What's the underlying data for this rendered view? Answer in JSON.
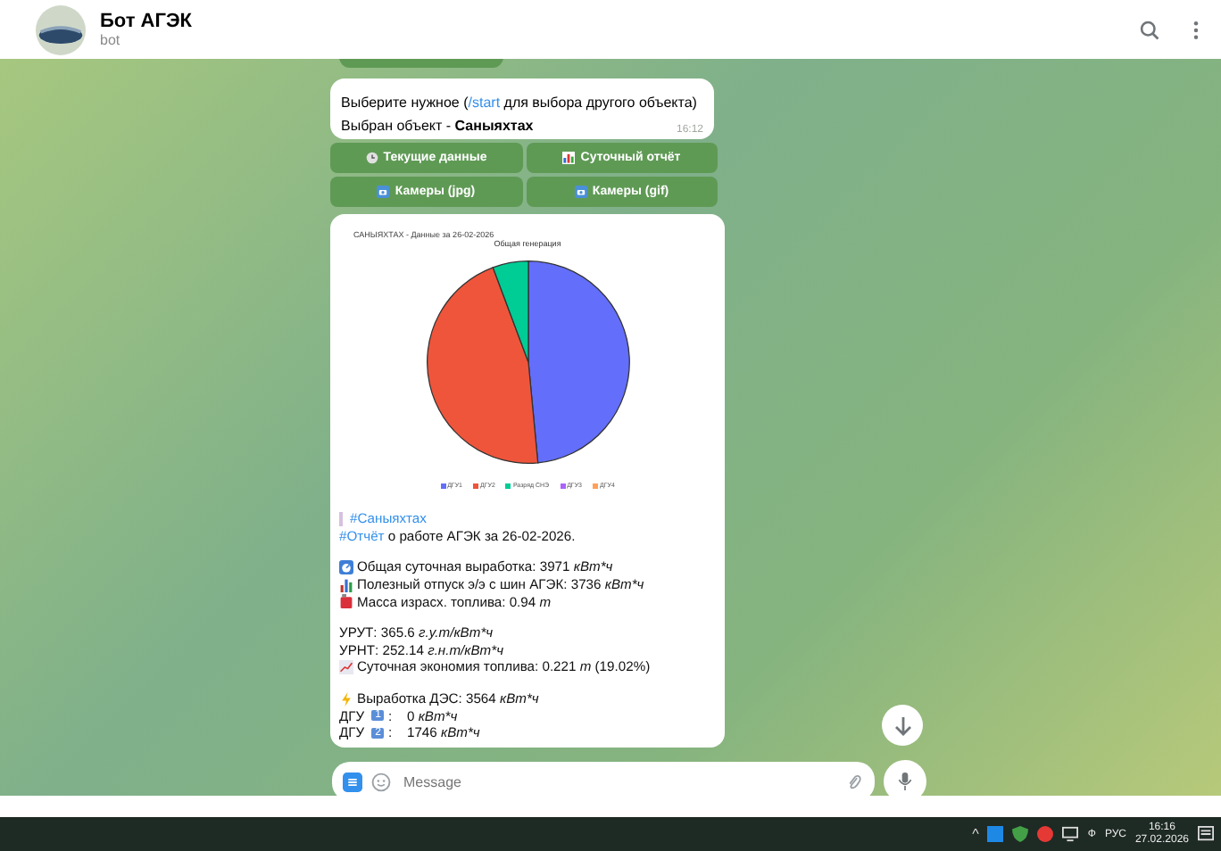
{
  "header": {
    "title": "Бот АГЭК",
    "subtitle": "bot"
  },
  "message": {
    "line1_before": "Выберите нужное (",
    "command": "/start",
    "line1_after": " для выбора другого объекта)",
    "line2": "Выбран объект - **Саныяхтах**",
    "time": "16:12"
  },
  "keyboard": [
    {
      "kind": "clock",
      "label": "Текущие данные"
    },
    {
      "kind": "chart",
      "label": "Суточный отчёт"
    },
    {
      "kind": "camera",
      "label": "Камеры (jpg)"
    },
    {
      "kind": "camera",
      "label": "Камеры (gif)"
    }
  ],
  "report_image": {
    "caption": "САНЫЯХТАХ - Данные за 26-02-2026",
    "chart_data": {
      "type": "pie",
      "title": "Общая генерация",
      "categories": [
        "ДГУ1",
        "ДГУ2",
        "Разряд СНЭ",
        "ДГУ3",
        "ДГУ4"
      ],
      "values": [
        48.5,
        45.8,
        5.7,
        0,
        0
      ],
      "colors": [
        "#636efa",
        "#ef553b",
        "#00cc96",
        "#ab63fa",
        "#ffa15a"
      ],
      "legend": "bottom"
    }
  },
  "report_text": [
    {
      "kind": "tag",
      "text": "#Саныяхтах"
    },
    {
      "kind": "link",
      "link": "#Отчёт",
      "text": " о работе АГЭК за 26-02-2026."
    },
    {
      "kind": "blank"
    },
    {
      "kind": "output",
      "text": "Общая суточная выработка: 3971 ",
      "unit": "кВт*ч"
    },
    {
      "kind": "supply",
      "text": "Полезный отпуск э/э с шин АГЭК: 3736 ",
      "unit": "кВт*ч"
    },
    {
      "kind": "fuel",
      "text": "Масса израсх. топлива: 0.94 ",
      "unit": "т"
    },
    {
      "kind": "blank"
    },
    {
      "kind": "plain",
      "text": "УРУТ: 365.6 ",
      "unit": "г.у.т/кВт*ч"
    },
    {
      "kind": "plain",
      "text": "УРНТ: 252.14 ",
      "unit": "г.н.т/кВт*ч"
    },
    {
      "kind": "saving",
      "text": "Суточная экономия топлива: 0.221 ",
      "unit": "т",
      "after": " (19.02%)"
    },
    {
      "kind": "blank"
    },
    {
      "kind": "power",
      "text": "Выработка ДЭС: 3564 ",
      "unit": "кВт*ч"
    },
    {
      "kind": "unit",
      "label": "ДГУ",
      "num": "1",
      "text": ":    0 ",
      "unit": "кВт*ч"
    },
    {
      "kind": "unit",
      "label": "ДГУ",
      "num": "2",
      "text": ":    1746 ",
      "unit": "кВт*ч"
    }
  ],
  "composer": {
    "placeholder": "Message"
  },
  "taskbar": {
    "tray_arrow": "^",
    "language_short": "Ф",
    "language": "РУС",
    "time": "16:16",
    "date": "27.02.2026"
  }
}
